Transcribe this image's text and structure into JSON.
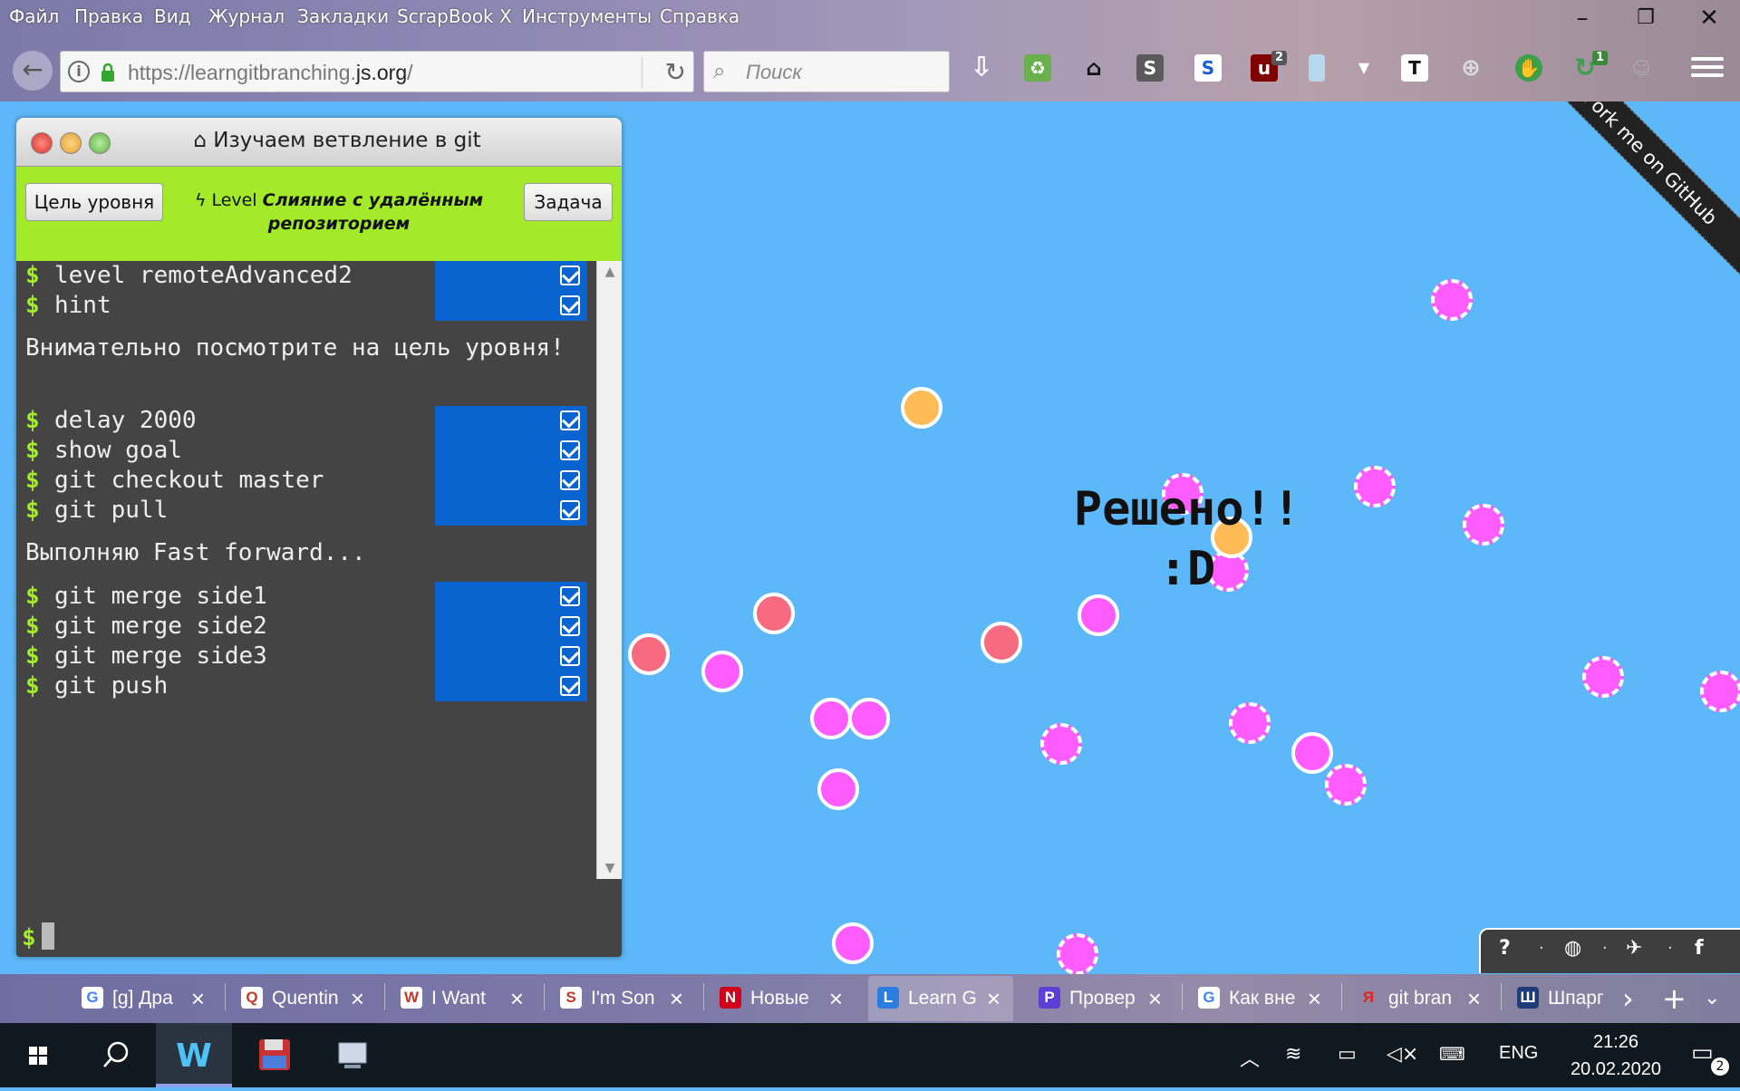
{
  "browser": {
    "menu": [
      "Файл",
      "Правка",
      "Вид",
      "Журнал",
      "Закладки",
      "ScrapBook X",
      "Инструменты",
      "Справка"
    ],
    "url_prefix": "https://learngitbranching.",
    "url_domain": "js.org",
    "url_suffix": "/",
    "search_placeholder": "Поиск",
    "badges": {
      "ublock": "2",
      "sync": "1"
    }
  },
  "page": {
    "fork_ribbon": "Fork me on GitHub",
    "solved_line1": "Решено!!",
    "solved_line2": ":D"
  },
  "terminal": {
    "title": "Изучаем ветвление в git",
    "goal_button": "Цель уровня",
    "level_prefix": "Level",
    "level_name": "Слияние с удалённым репозиторием",
    "task_button": "Задача",
    "lines": [
      {
        "type": "cmd",
        "text": "level remoteAdvanced2"
      },
      {
        "type": "cmd",
        "text": "hint"
      },
      {
        "type": "out",
        "text": "Внимательно посмотрите на цель уровня!"
      },
      {
        "type": "cmd",
        "text": "delay 2000"
      },
      {
        "type": "cmd",
        "text": "show goal"
      },
      {
        "type": "cmd",
        "text": "git checkout master"
      },
      {
        "type": "cmd",
        "text": "git pull"
      },
      {
        "type": "out",
        "text": "Выполняю Fast forward..."
      },
      {
        "type": "cmd",
        "text": "git merge side1"
      },
      {
        "type": "cmd",
        "text": "git merge side2"
      },
      {
        "type": "cmd",
        "text": "git merge side3"
      },
      {
        "type": "cmd",
        "text": "git push"
      }
    ],
    "prompt": "$"
  },
  "tabs": [
    {
      "label": "[g] Дра",
      "icon": "G"
    },
    {
      "label": "Quentin",
      "icon": "Q"
    },
    {
      "label": "I Want",
      "icon": "W"
    },
    {
      "label": "I'm Son",
      "icon": "S"
    },
    {
      "label": "Новые",
      "icon": "N"
    },
    {
      "label": "Learn G",
      "icon": "L",
      "active": true
    },
    {
      "label": "Провер",
      "icon": "P"
    },
    {
      "label": "Как вне",
      "icon": "G"
    },
    {
      "label": "git bran",
      "icon": "Я"
    },
    {
      "label": "Шпарг",
      "icon": "Ш"
    }
  ],
  "taskbar": {
    "lang": "ENG",
    "time": "21:26",
    "date": "20.02.2020",
    "notifications": "2"
  },
  "colors": {
    "accent_green": "#a3ea2a",
    "page_bg": "#5cb8f8",
    "check_blue": "#0a64d0",
    "commit_pink": "#ff5cff",
    "commit_red": "#f86a80",
    "commit_orange": "#ffbb55"
  }
}
